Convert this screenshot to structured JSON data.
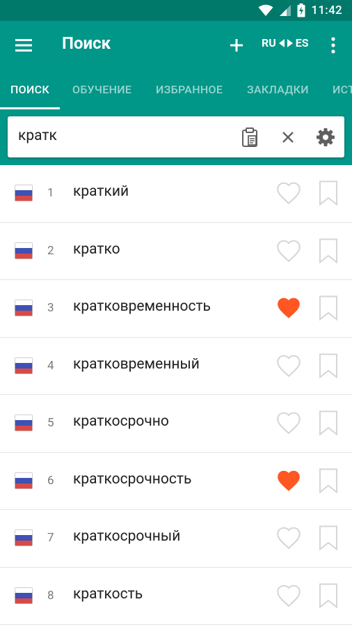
{
  "status_bar": {
    "time": "11:42"
  },
  "app_bar": {
    "title": "Поиск",
    "lang_from": "RU",
    "lang_to": "ES"
  },
  "tabs": [
    {
      "label": "ПОИСК",
      "active": true
    },
    {
      "label": "ОБУЧЕНИЕ",
      "active": false
    },
    {
      "label": "ИЗБРАННОЕ",
      "active": false
    },
    {
      "label": "ЗАКЛАДКИ",
      "active": false
    },
    {
      "label": "ИСТ",
      "active": false
    }
  ],
  "search": {
    "value": "кратк"
  },
  "results": [
    {
      "index": "1",
      "word": "краткий",
      "favorite": false
    },
    {
      "index": "2",
      "word": "кратко",
      "favorite": false
    },
    {
      "index": "3",
      "word": "кратковременность",
      "favorite": true
    },
    {
      "index": "4",
      "word": "кратковременный",
      "favorite": false
    },
    {
      "index": "5",
      "word": "краткосрочно",
      "favorite": false
    },
    {
      "index": "6",
      "word": "краткосрочность",
      "favorite": true
    },
    {
      "index": "7",
      "word": "краткосрочный",
      "favorite": false
    },
    {
      "index": "8",
      "word": "краткость",
      "favorite": false
    }
  ],
  "colors": {
    "primary": "#009688",
    "primary_dark": "#00796b",
    "favorite_active": "#ff5722",
    "icon_inactive": "#d6d6d6"
  }
}
